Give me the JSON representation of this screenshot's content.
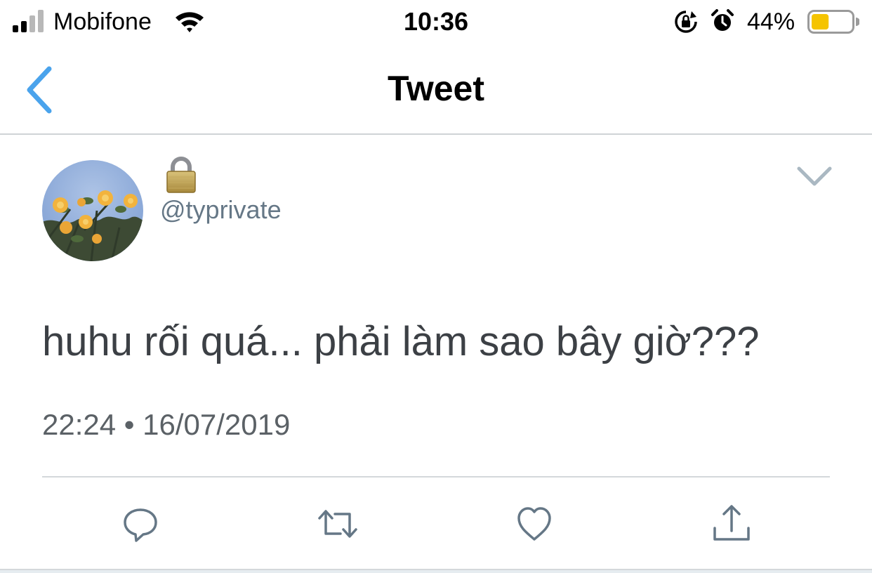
{
  "status_bar": {
    "carrier": "Mobifone",
    "time": "10:36",
    "battery_percent": "44%",
    "battery_level": 0.44,
    "signal_bars_filled": 2,
    "signal_bars_total": 4,
    "icons": [
      "signal-icon",
      "wifi-icon",
      "rotation-lock-icon",
      "alarm-icon",
      "battery-icon"
    ]
  },
  "nav": {
    "title": "Tweet",
    "back_icon": "chevron-left-icon"
  },
  "tweet": {
    "display_name_emoji": "lock-emoji",
    "handle": "@typrivate",
    "text": "huhu rối quá... phải làm sao bây giờ???",
    "timestamp": "22:24 • 16/07/2019",
    "menu_icon": "chevron-down-icon"
  },
  "actions": {
    "icons": [
      "reply-icon",
      "retweet-icon",
      "like-icon",
      "share-icon"
    ]
  },
  "colors": {
    "accent": "#4aa3ec",
    "secondary_text": "#657786",
    "tweet_text": "#3c4045",
    "icon_gray": "#657786",
    "battery_fill": "#f5c400",
    "divider": "#d4d8db"
  }
}
